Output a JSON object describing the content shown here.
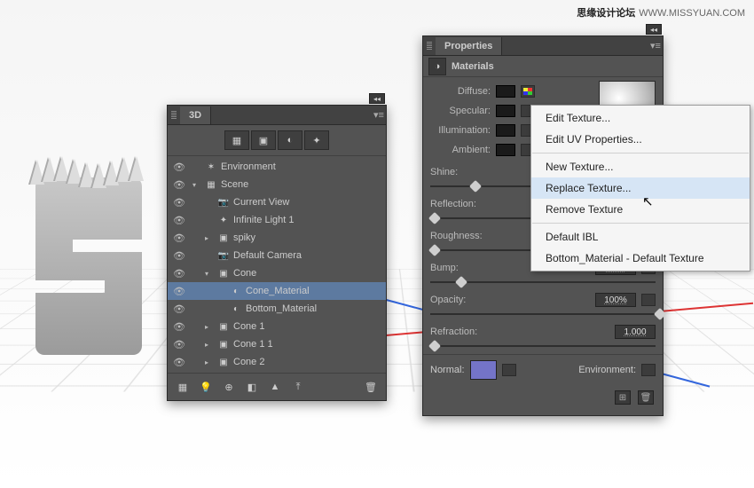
{
  "watermark": {
    "cn": "思缘设计论坛",
    "en": "WWW.MISSYUAN.COM"
  },
  "panel3d": {
    "title": "3D",
    "filters": [
      "scene-icon",
      "mesh-icon",
      "material-icon",
      "light-icon"
    ],
    "items": [
      {
        "label": "Environment",
        "icon": "globe",
        "depth": 0,
        "twisty": ""
      },
      {
        "label": "Scene",
        "icon": "scene",
        "depth": 0,
        "twisty": "▾"
      },
      {
        "label": "Current View",
        "icon": "camera",
        "depth": 1,
        "twisty": ""
      },
      {
        "label": "Infinite Light 1",
        "icon": "light",
        "depth": 1,
        "twisty": ""
      },
      {
        "label": "spiky",
        "icon": "mesh",
        "depth": 1,
        "twisty": "▸"
      },
      {
        "label": "Default Camera",
        "icon": "camera",
        "depth": 1,
        "twisty": ""
      },
      {
        "label": "Cone",
        "icon": "mesh",
        "depth": 1,
        "twisty": "▾"
      },
      {
        "label": "Cone_Material",
        "icon": "material",
        "depth": 2,
        "twisty": "",
        "sel": true
      },
      {
        "label": "Bottom_Material",
        "icon": "material",
        "depth": 2,
        "twisty": ""
      },
      {
        "label": "Cone 1",
        "icon": "mesh",
        "depth": 1,
        "twisty": "▸"
      },
      {
        "label": "Cone 1 1",
        "icon": "mesh",
        "depth": 1,
        "twisty": "▸"
      },
      {
        "label": "Cone 2",
        "icon": "mesh",
        "depth": 1,
        "twisty": "▸"
      }
    ]
  },
  "panelProps": {
    "title": "Properties",
    "section": "Materials",
    "colors": [
      {
        "key": "diffuse",
        "label": "Diffuse:",
        "hasTex": true
      },
      {
        "key": "specular",
        "label": "Specular:",
        "hasTex": false
      },
      {
        "key": "illumination",
        "label": "Illumination:",
        "hasTex": false
      },
      {
        "key": "ambient",
        "label": "Ambient:",
        "hasTex": false
      }
    ],
    "sliders": [
      {
        "key": "shine",
        "label": "Shine:",
        "value": "",
        "thumb": 18
      },
      {
        "key": "reflection",
        "label": "Reflection:",
        "value": "",
        "thumb": 0
      },
      {
        "key": "roughness",
        "label": "Roughness:",
        "value": "",
        "thumb": 0
      },
      {
        "key": "bump",
        "label": "Bump:",
        "value": "10%",
        "thumb": 12,
        "folder": true
      },
      {
        "key": "opacity",
        "label": "Opacity:",
        "value": "100%",
        "thumb": 100,
        "folder": true
      },
      {
        "key": "refraction",
        "label": "Refraction:",
        "value": "1.000",
        "thumb": 0
      }
    ],
    "normal_label": "Normal:",
    "env_label": "Environment:"
  },
  "ctx": {
    "items": [
      {
        "label": "Edit Texture..."
      },
      {
        "label": "Edit UV Properties..."
      },
      {
        "sep": true
      },
      {
        "label": "New Texture..."
      },
      {
        "label": "Replace Texture...",
        "hov": true
      },
      {
        "label": "Remove Texture"
      },
      {
        "sep": true
      },
      {
        "label": "Default IBL"
      },
      {
        "label": "Bottom_Material - Default Texture"
      }
    ]
  }
}
